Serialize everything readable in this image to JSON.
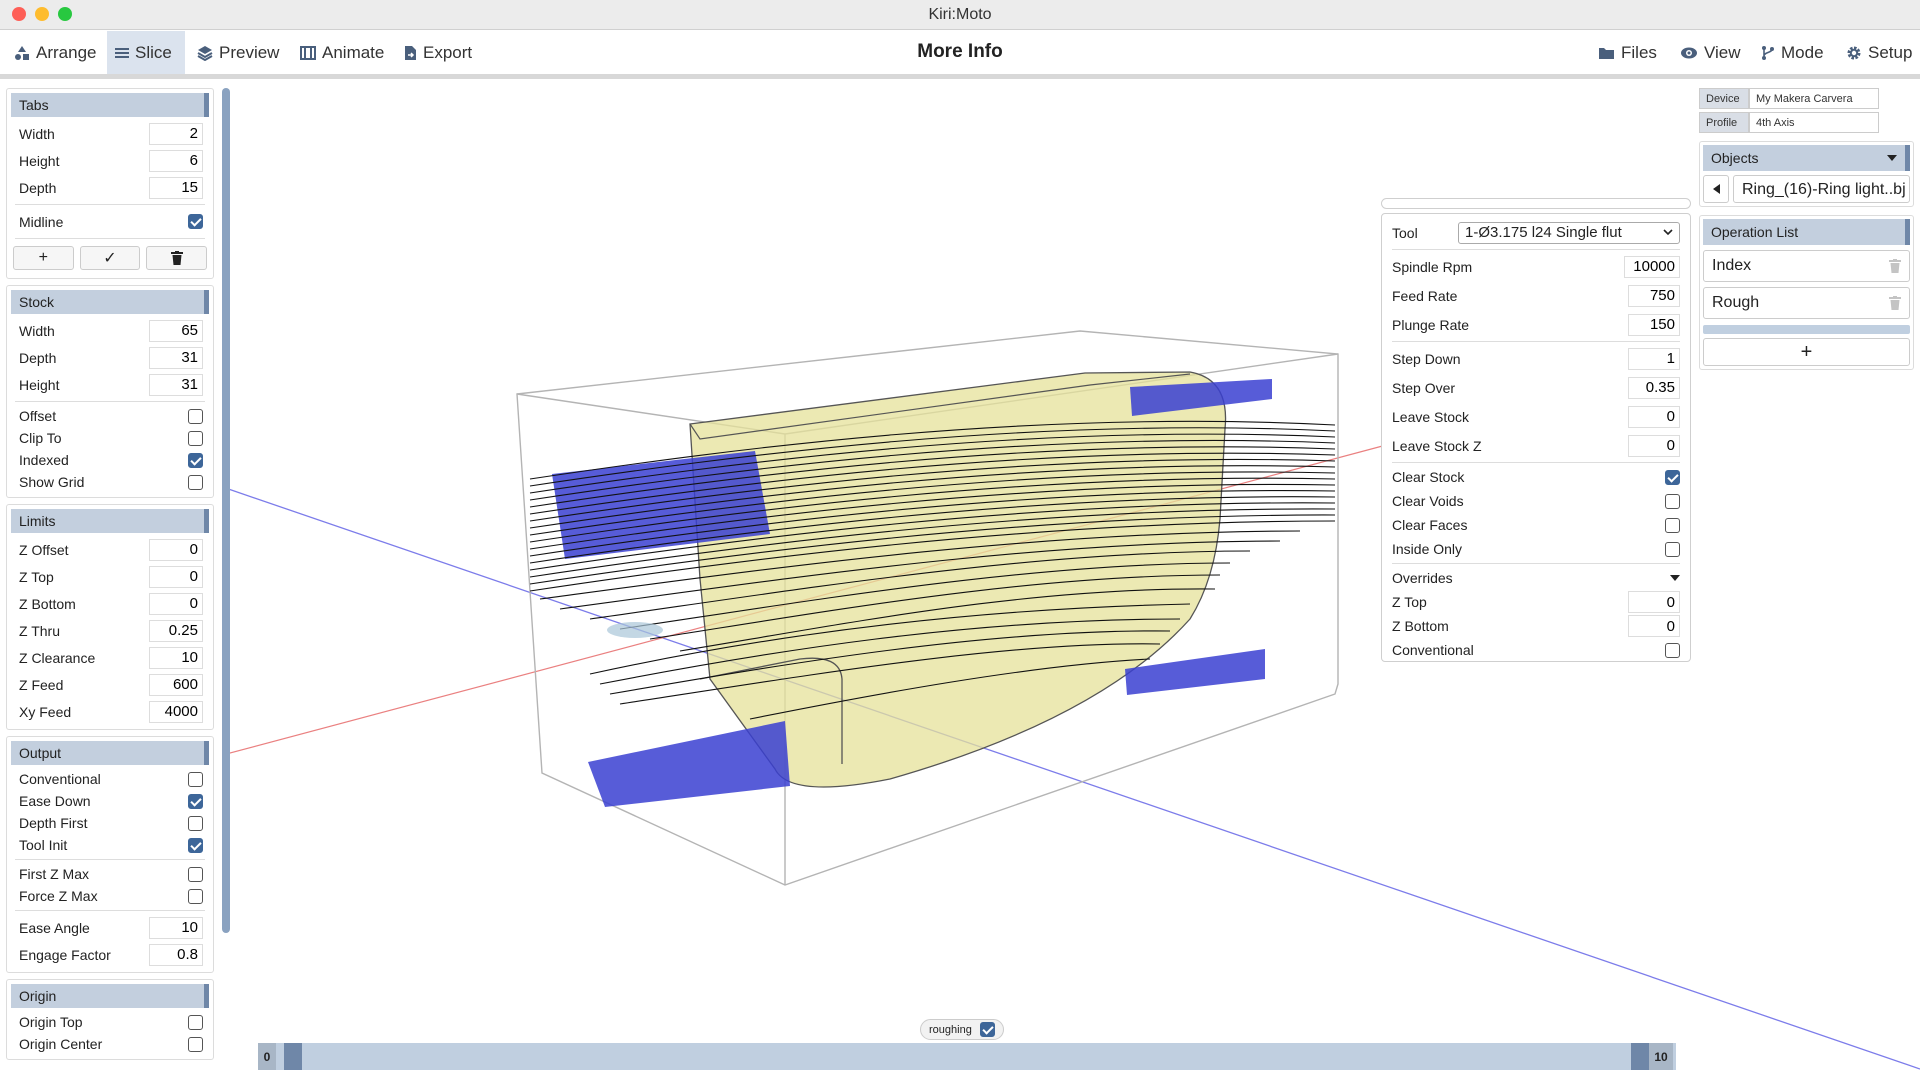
{
  "window": {
    "title": "Kiri:Moto"
  },
  "menu": {
    "arrange": "Arrange",
    "slice": "Slice",
    "preview": "Preview",
    "animate": "Animate",
    "export": "Export",
    "more_info": "More Info",
    "files": "Files",
    "view": "View",
    "mode": "Mode",
    "setup": "Setup"
  },
  "tabs": {
    "title": "Tabs",
    "width_label": "Width",
    "width": "2",
    "height_label": "Height",
    "height": "6",
    "depth_label": "Depth",
    "depth": "15",
    "midline_label": "Midline",
    "midline": true
  },
  "stock": {
    "title": "Stock",
    "width_label": "Width",
    "width": "65",
    "depth_label": "Depth",
    "depth": "31",
    "height_label": "Height",
    "height": "31",
    "offset_label": "Offset",
    "offset": false,
    "clip_label": "Clip To",
    "clip": false,
    "indexed_label": "Indexed",
    "indexed": true,
    "grid_label": "Show Grid",
    "grid": false
  },
  "limits": {
    "title": "Limits",
    "zoffset_label": "Z Offset",
    "zoffset": "0",
    "ztop_label": "Z Top",
    "ztop": "0",
    "zbottom_label": "Z Bottom",
    "zbottom": "0",
    "zthru_label": "Z Thru",
    "zthru": "0.25",
    "zclear_label": "Z Clearance",
    "zclear": "10",
    "zfeed_label": "Z Feed",
    "zfeed": "600",
    "xyfeed_label": "Xy Feed",
    "xyfeed": "4000"
  },
  "output": {
    "title": "Output",
    "conventional_label": "Conventional",
    "conventional": false,
    "easedown_label": "Ease Down",
    "easedown": true,
    "depthfirst_label": "Depth First",
    "depthfirst": false,
    "toolinit_label": "Tool Init",
    "toolinit": true,
    "firstz_label": "First Z Max",
    "firstz": false,
    "forcez_label": "Force Z Max",
    "forcez": false,
    "easeangle_label": "Ease Angle",
    "easeangle": "10",
    "engage_label": "Engage Factor",
    "engage": "0.8"
  },
  "origin": {
    "title": "Origin",
    "top_label": "Origin Top",
    "top": false,
    "center_label": "Origin Center",
    "center": false
  },
  "device": {
    "device_label": "Device",
    "device": "My Makera Carvera",
    "profile_label": "Profile",
    "profile": "4th Axis"
  },
  "objects": {
    "title": "Objects",
    "name": "Ring_(16)-Ring light..bj"
  },
  "oplist": {
    "title": "Operation List",
    "items": [
      "Index",
      "Rough"
    ],
    "add": "+"
  },
  "op": {
    "tool_label": "Tool",
    "tool": "1-Ø3.175 l24 Single flut",
    "spindle_label": "Spindle Rpm",
    "spindle": "10000",
    "feed_label": "Feed Rate",
    "feed": "750",
    "plunge_label": "Plunge Rate",
    "plunge": "150",
    "stepdown_label": "Step Down",
    "stepdown": "1",
    "stepover_label": "Step Over",
    "stepover": "0.35",
    "leave_label": "Leave Stock",
    "leave": "0",
    "leavez_label": "Leave Stock Z",
    "leavez": "0",
    "clearstock_label": "Clear Stock",
    "clearstock": true,
    "clearvoids_label": "Clear Voids",
    "clearvoids": false,
    "clearfaces_label": "Clear Faces",
    "clearfaces": false,
    "inside_label": "Inside Only",
    "inside": false,
    "overrides_label": "Overrides",
    "oztop_label": "Z Top",
    "oztop": "0",
    "ozbottom_label": "Z Bottom",
    "ozbottom": "0",
    "oconv_label": "Conventional",
    "oconv": false
  },
  "layers": {
    "chip_label": "roughing",
    "chip": true,
    "min": "0",
    "max": "10"
  },
  "colors": {
    "accent": "#6f87a8",
    "header": "#c3cfde",
    "stock_blue": "#3a3fd1",
    "part_yellow": "#e6e29a"
  }
}
